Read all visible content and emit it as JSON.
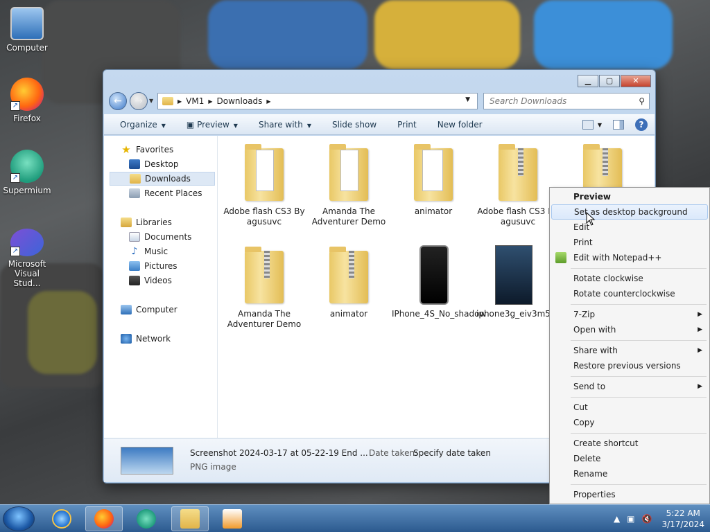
{
  "desktop": {
    "icons": [
      {
        "label": "Computer",
        "icon": "computer-icon"
      },
      {
        "label": "Firefox",
        "icon": "firefox-icon",
        "shortcut": true
      },
      {
        "label": "Supermium",
        "icon": "supermium-icon",
        "shortcut": true
      },
      {
        "label": "Microsoft Visual Stud...",
        "icon": "visual-studio-icon",
        "shortcut": true
      }
    ]
  },
  "explorer": {
    "breadcrumb": [
      "VM1",
      "Downloads"
    ],
    "search_placeholder": "Search Downloads",
    "toolbar": {
      "organize": "Organize",
      "preview": "Preview",
      "share_with": "Share with",
      "slide_show": "Slide show",
      "print": "Print",
      "new_folder": "New folder"
    },
    "nav": {
      "favorites": "Favorites",
      "desktop": "Desktop",
      "downloads": "Downloads",
      "recent_places": "Recent Places",
      "libraries": "Libraries",
      "documents": "Documents",
      "music": "Music",
      "pictures": "Pictures",
      "videos": "Videos",
      "computer": "Computer",
      "network": "Network"
    },
    "items": [
      {
        "name": "Adobe flash CS3 By agusuvc",
        "kind": "folder"
      },
      {
        "name": "Amanda The Adventurer Demo",
        "kind": "folder"
      },
      {
        "name": "animator",
        "kind": "folder"
      },
      {
        "name": "Adobe flash CS3 By agusuvc",
        "kind": "zip"
      },
      {
        "name": "",
        "kind": "zip"
      },
      {
        "name": "Amanda The Adventurer Demo",
        "kind": "zip"
      },
      {
        "name": "animator",
        "kind": "zip"
      },
      {
        "name": "IPhone_4S_No_shadow",
        "kind": "image"
      },
      {
        "name": "iphone3g_eiv3m5vk",
        "kind": "image"
      }
    ],
    "details": {
      "filename": "Screenshot 2024-03-17 at 05-22-19 End ...",
      "filetype": "PNG image",
      "date_label": "Date taken:",
      "date_value": "Specify date taken"
    }
  },
  "context_menu": {
    "items": {
      "preview": "Preview",
      "set_background": "Set as desktop background",
      "edit": "Edit",
      "print": "Print",
      "edit_notepad": "Edit with Notepad++",
      "rotate_cw": "Rotate clockwise",
      "rotate_ccw": "Rotate counterclockwise",
      "sevenzip": "7-Zip",
      "open_with": "Open with",
      "share_with": "Share with",
      "restore": "Restore previous versions",
      "send_to": "Send to",
      "cut": "Cut",
      "copy": "Copy",
      "create_shortcut": "Create shortcut",
      "delete": "Delete",
      "rename": "Rename",
      "properties": "Properties"
    }
  },
  "taskbar": {
    "time": "5:22 AM",
    "date": "3/17/2024"
  }
}
